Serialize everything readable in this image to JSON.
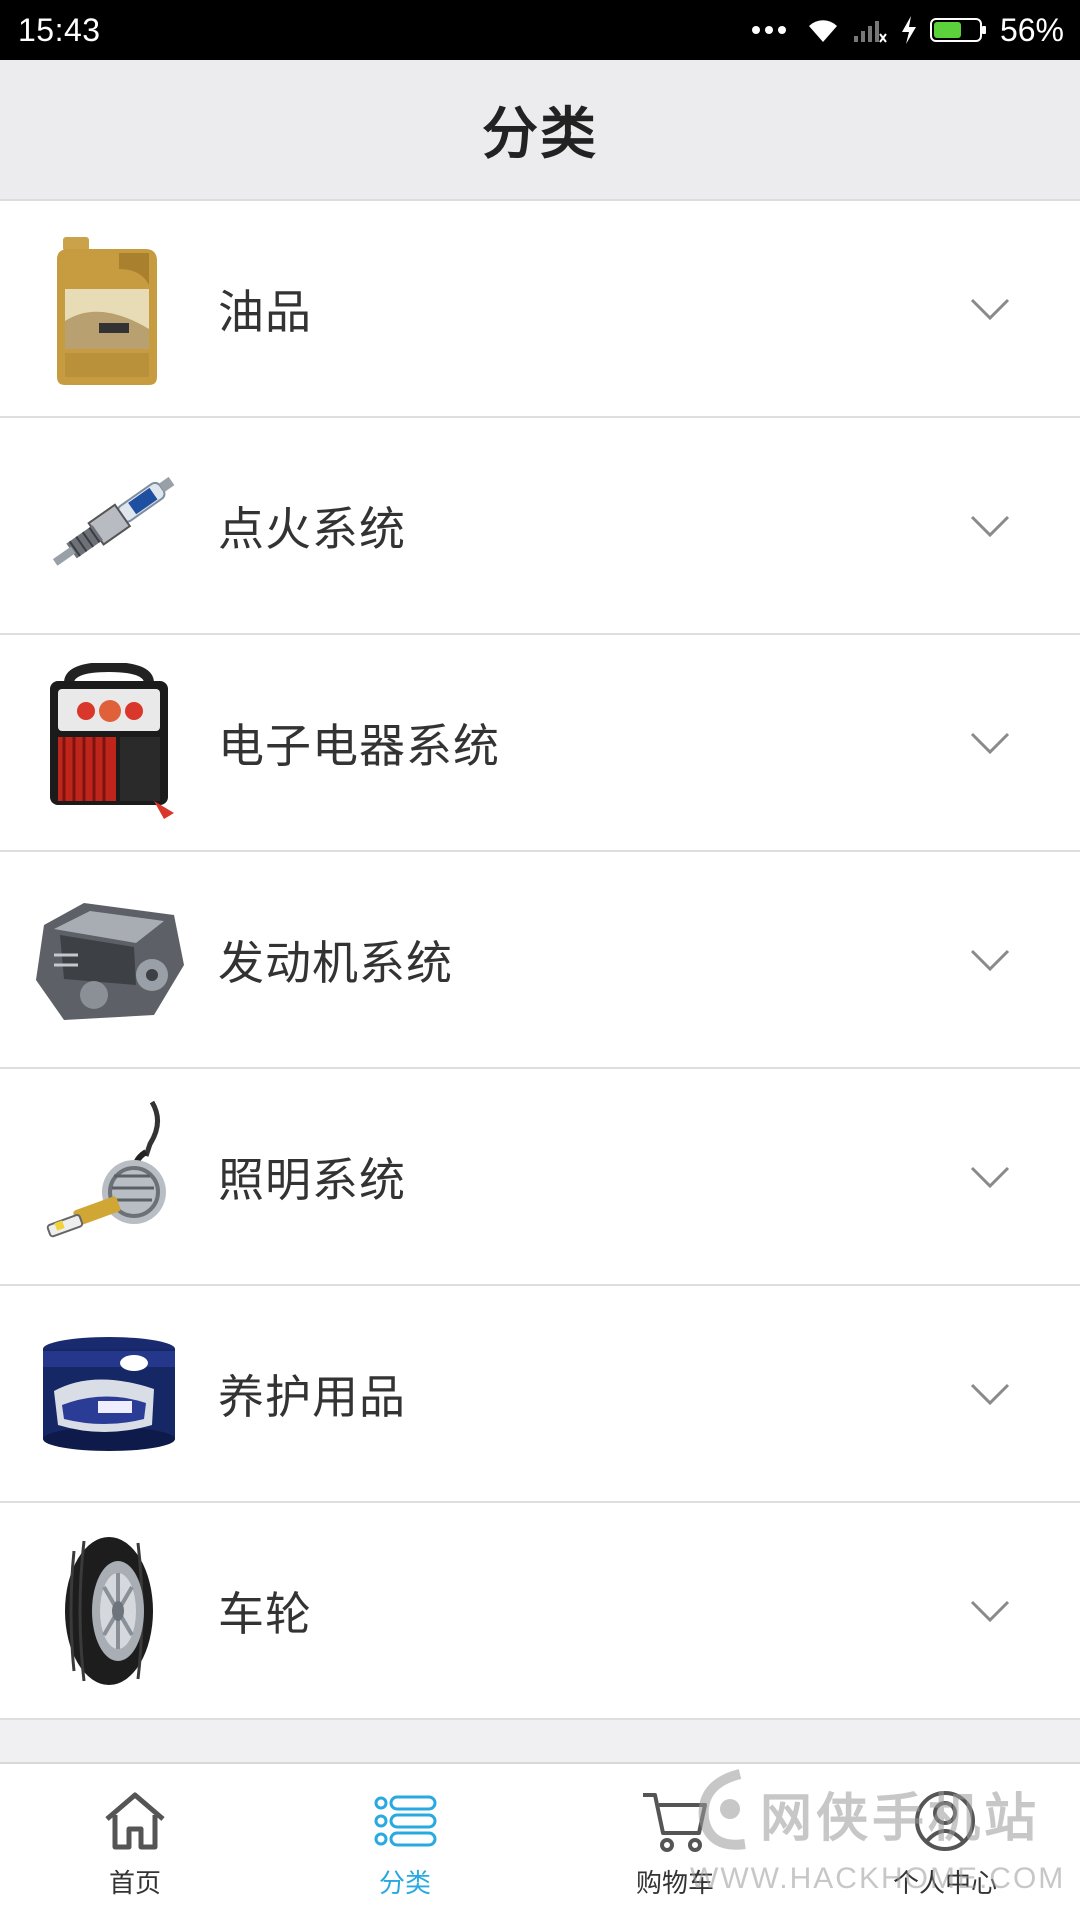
{
  "status_bar": {
    "time": "15:43",
    "battery": "56%",
    "icons": [
      "more-dots-icon",
      "wifi-icon",
      "signal-icon",
      "charging-icon",
      "battery-icon"
    ]
  },
  "header": {
    "title": "分类"
  },
  "categories": [
    {
      "label": "油品",
      "icon": "oil-can-icon"
    },
    {
      "label": "点火系统",
      "icon": "spark-plug-icon"
    },
    {
      "label": "电子电器系统",
      "icon": "jump-starter-icon"
    },
    {
      "label": "发动机系统",
      "icon": "engine-icon"
    },
    {
      "label": "照明系统",
      "icon": "headlight-bulb-icon"
    },
    {
      "label": "养护用品",
      "icon": "car-wax-icon"
    },
    {
      "label": "车轮",
      "icon": "tire-icon"
    }
  ],
  "tabbar": {
    "tabs": [
      {
        "label": "首页",
        "icon": "home-icon",
        "active": false
      },
      {
        "label": "分类",
        "icon": "list-icon",
        "active": true
      },
      {
        "label": "购物车",
        "icon": "cart-icon",
        "active": false
      },
      {
        "label": "个人中心",
        "icon": "user-icon",
        "active": false
      }
    ]
  },
  "watermark": {
    "name": "网侠手机站",
    "url": "WWW.HACKHOME.COM"
  },
  "colors": {
    "accent": "#29a9e1",
    "header_bg": "#ececee",
    "status_bar_bg": "#000000",
    "battery_green": "#5bd13b"
  }
}
